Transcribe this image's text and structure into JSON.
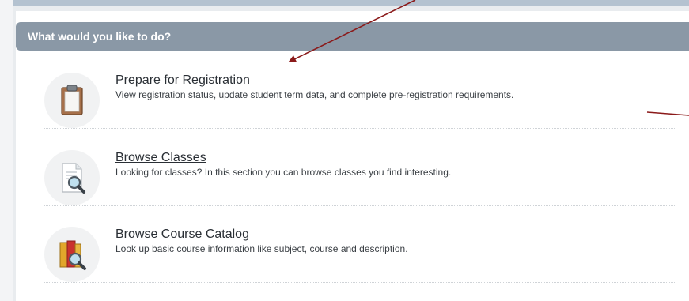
{
  "panel": {
    "header": "What would you like to do?"
  },
  "options": [
    {
      "title": "Prepare for Registration",
      "description": "View registration status, update student term data, and complete pre-registration requirements.",
      "icon": "clipboard-icon"
    },
    {
      "title": "Browse Classes",
      "description": "Looking for classes? In this section you can browse classes you find interesting.",
      "icon": "document-search-icon"
    },
    {
      "title": "Browse Course Catalog",
      "description": "Look up basic course information like subject, course and description.",
      "icon": "book-search-icon"
    }
  ],
  "colors": {
    "header_bg": "#8a98a6",
    "annotation_arrow": "#8b1a1a"
  }
}
